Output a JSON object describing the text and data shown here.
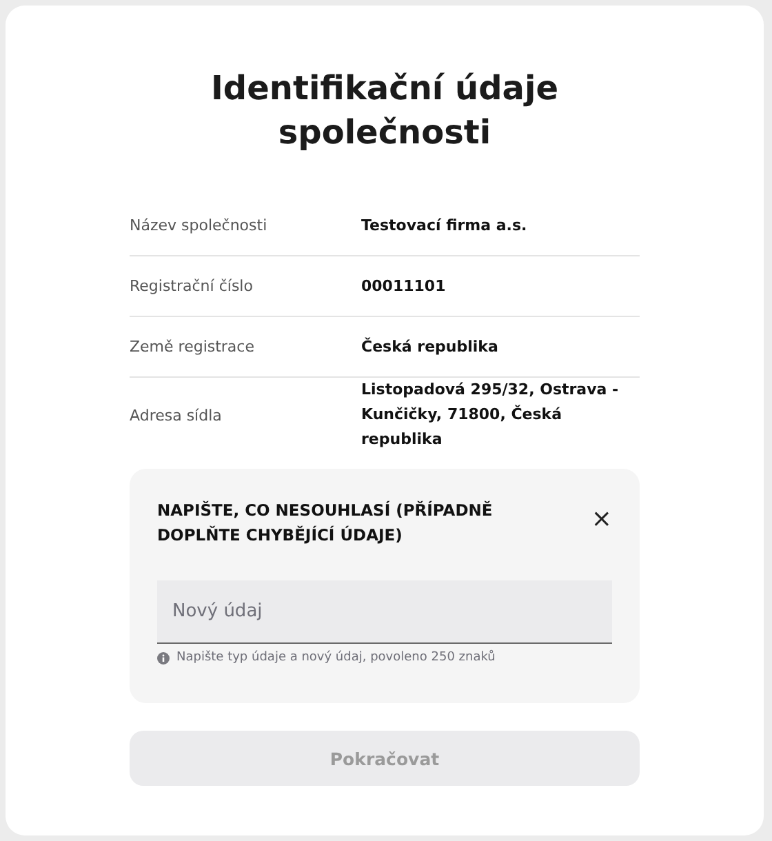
{
  "title": "Identifikační údaje společnosti",
  "fields": [
    {
      "label": "Název společnosti",
      "value": "Testovací firma a.s."
    },
    {
      "label": "Registrační číslo",
      "value": "00011101"
    },
    {
      "label": "Země registrace",
      "value": "Česká republika"
    },
    {
      "label": "Adresa sídla",
      "value": "Listopadová 295/32, Ostrava - Kunčičky, 71800, Česká republika"
    }
  ],
  "dispute_panel": {
    "heading": "NAPIŠTE, CO NESOUHLASÍ (PŘÍPADNĚ DOPLŇTE CHYBĚJÍCÍ ÚDAJE)",
    "close": "×",
    "input": {
      "placeholder": "Nový údaj"
    },
    "hint": "Napište typ údaje a nový údaj, povoleno 250 znaků"
  },
  "continue_button": {
    "label": "Pokračovat",
    "disabled": true
  }
}
